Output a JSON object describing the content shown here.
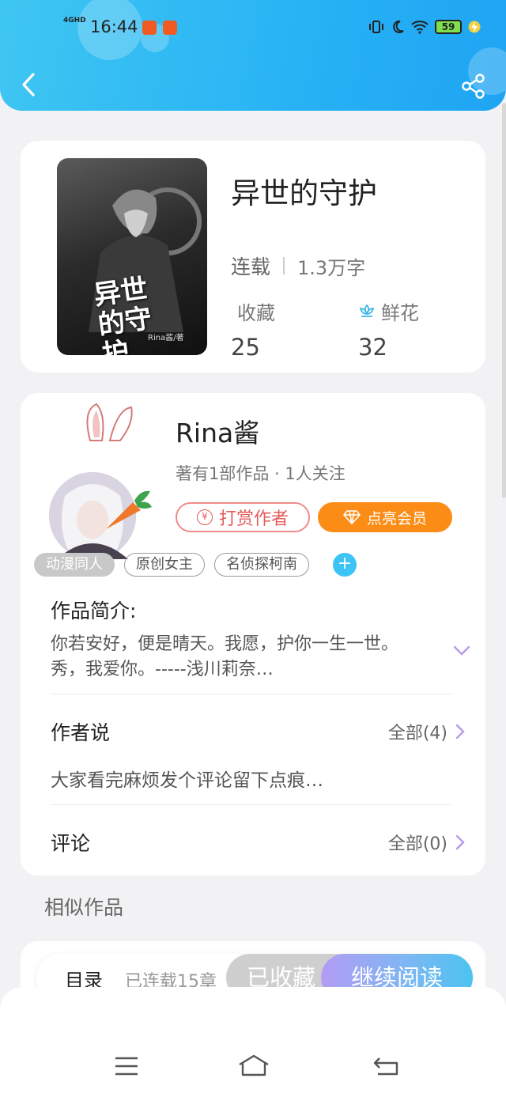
{
  "status_bar": {
    "signal": "4GHD",
    "time": "16:44",
    "battery": "59"
  },
  "book": {
    "title": "异世的守护",
    "cover_title": "异世的守护",
    "cover_author": "Rina酱/著",
    "status": "连载",
    "word_count": "1.3万字",
    "fav_label": "收藏",
    "fav_count": "25",
    "flower_label": "鲜花",
    "flower_count": "32"
  },
  "author": {
    "name": "Rina酱",
    "summary": "著有1部作品 · 1人关注",
    "tip_label": "打赏作者",
    "vip_label": "点亮会员"
  },
  "tags": [
    "动漫同人",
    "原创女主",
    "名侦探柯南"
  ],
  "intro": {
    "heading": "作品简介:",
    "text": "你若安好，便是晴天。我愿，护你一生一世。秀，我爱你。-----浅川莉奈…"
  },
  "author_says": {
    "heading": "作者说",
    "all_label": "全部(4)",
    "text": "大家看完麻烦发个评论留下点痕…"
  },
  "comments": {
    "heading": "评论",
    "all_label": "全部(0)"
  },
  "similar": {
    "heading": "相似作品"
  },
  "bottom": {
    "toc_label": "目录",
    "toc_count": "已连载15章",
    "fav_button": "已收藏",
    "read_button": "继续阅读"
  },
  "colors": {
    "header_start": "#3fc6f2",
    "header_end": "#1fa4f3",
    "tip_red": "#e55b5b",
    "vip_orange": "#fb8c16",
    "tag_add_blue": "#3cc5f4"
  }
}
